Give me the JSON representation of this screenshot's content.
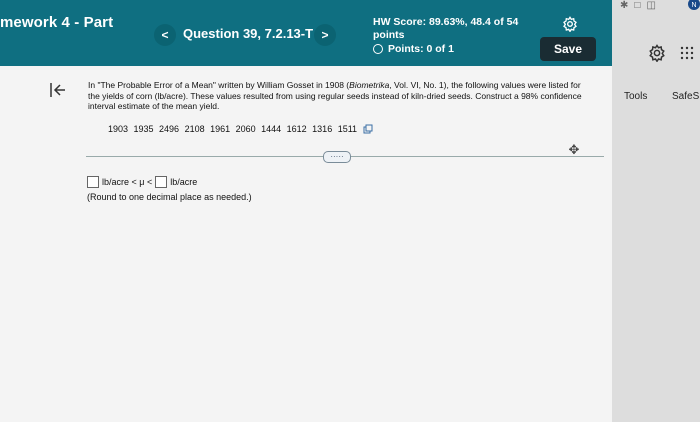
{
  "header": {
    "assignment_title": "mework 4 - Part",
    "prev_label": "<",
    "question_label": "Question 39, 7.2.13-T",
    "next_label": ">",
    "hw_score": "HW Score: 89.63%, 48.4 of 54 points",
    "points": "Points: 0 of 1",
    "save_label": "Save"
  },
  "question": {
    "prompt_part1": "In \"The Probable Error of a Mean\" written by William Gosset in 1908 (",
    "prompt_italic": "Biometrika",
    "prompt_part2": ", Vol. VI, No. 1), the following values were listed for the yields of corn (lb/acre). These values resulted from using regular seeds instead of kiln-dried seeds. Construct a 98% confidence interval estimate of the mean yield.",
    "data_values": "1903 1935 2496 2108 1961 2060 1444 1612 1316 1511",
    "more_label": "·····",
    "answer_unit_left": "lb/acre < μ <",
    "answer_unit_right": "lb/acre",
    "round_note": "(Round to one decimal place as needed.)"
  },
  "sidebar": {
    "avatar_letter": "N",
    "tools_label": "Tools",
    "safes_label": "SafeS"
  },
  "colors": {
    "header_bg": "#0f6f81",
    "save_bg": "#1a2c33",
    "content_bg": "#f4f4f4"
  }
}
